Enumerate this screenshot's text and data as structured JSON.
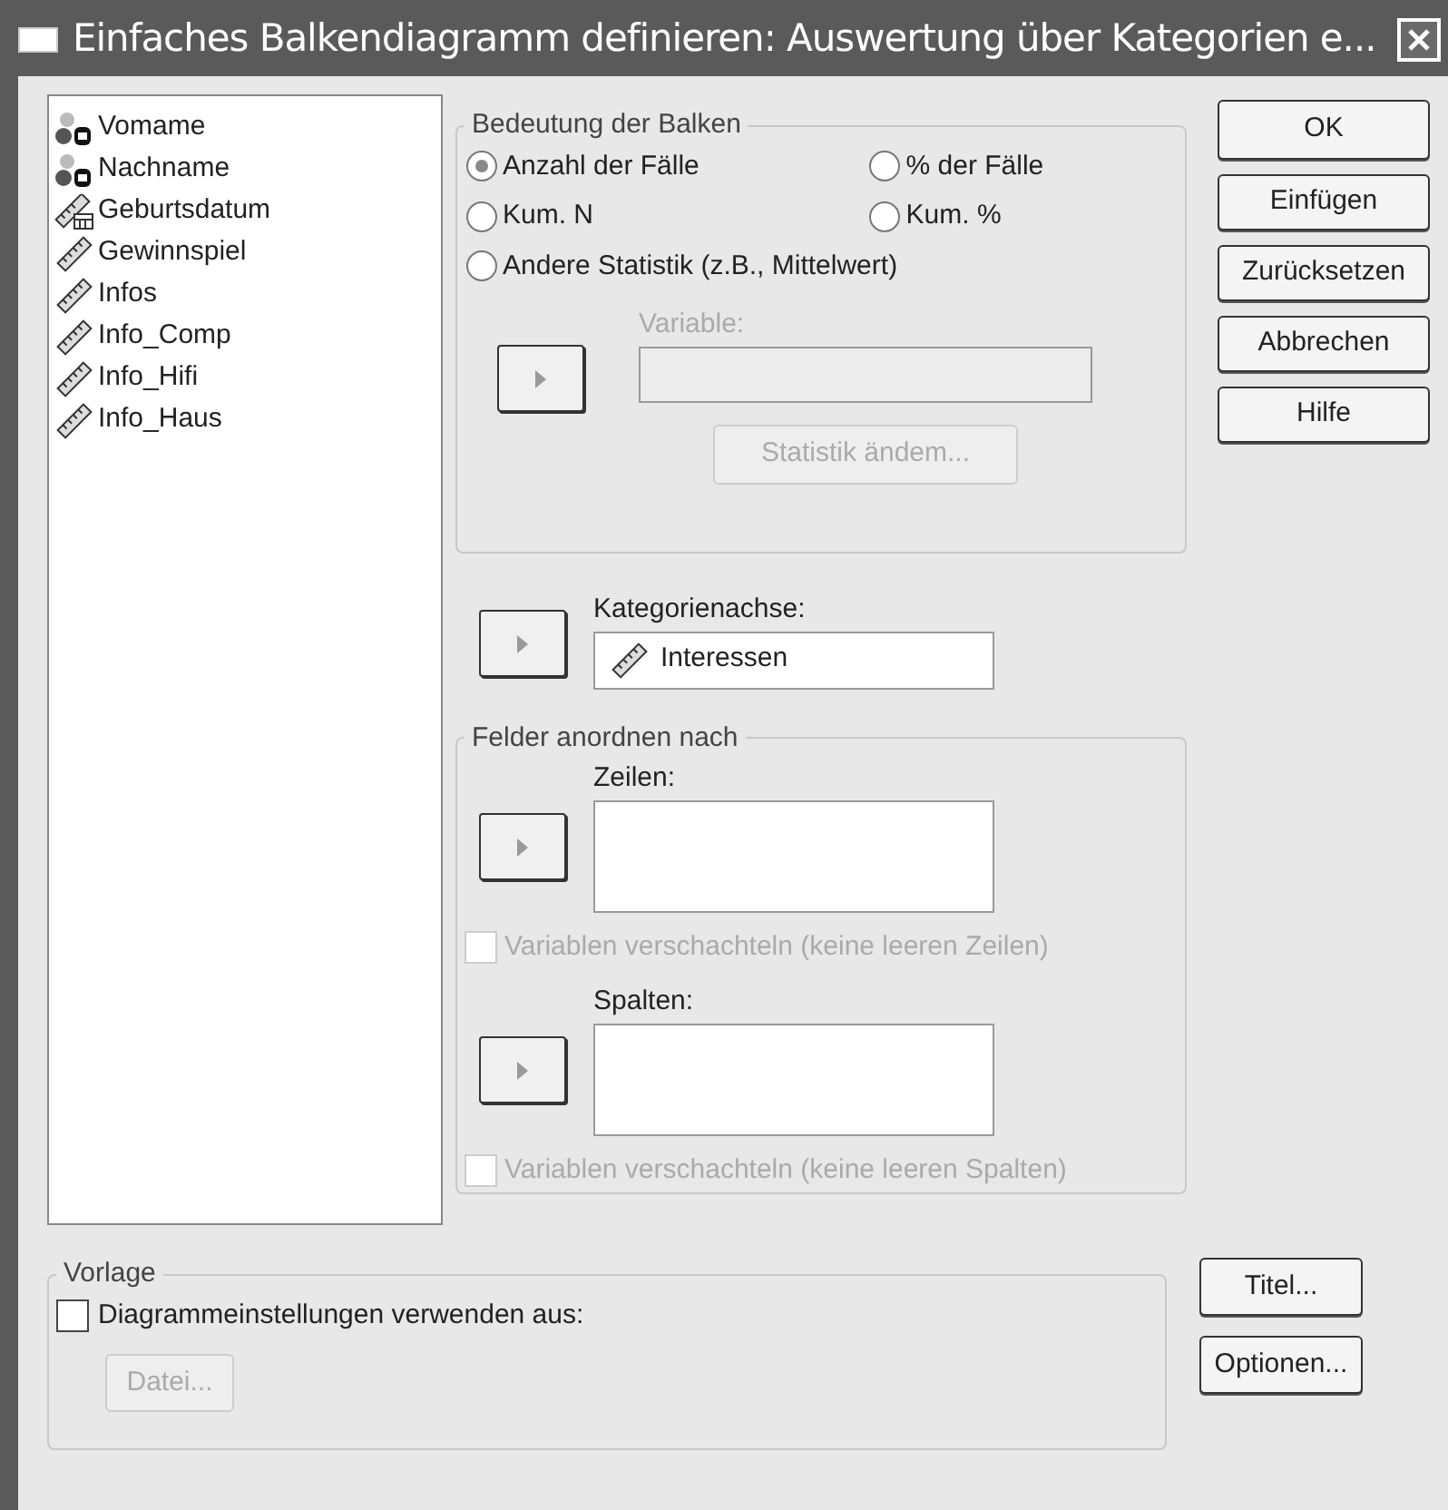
{
  "window": {
    "title": "Einfaches Balkendiagramm definieren: Auswertung über Kategorien e..."
  },
  "variables": [
    {
      "name": "Vomame",
      "kind": "string"
    },
    {
      "name": "Nachname",
      "kind": "string"
    },
    {
      "name": "Geburtsdatum",
      "kind": "date"
    },
    {
      "name": "Gewinnspiel",
      "kind": "scale"
    },
    {
      "name": "Infos",
      "kind": "scale"
    },
    {
      "name": "Info_Comp",
      "kind": "scale"
    },
    {
      "name": "Info_Hifi",
      "kind": "scale"
    },
    {
      "name": "Info_Haus",
      "kind": "scale"
    }
  ],
  "bar_meaning": {
    "legend": "Bedeutung der Balken",
    "options": [
      {
        "label": "Anzahl der Fälle",
        "selected": true
      },
      {
        "label": "% der Fälle",
        "selected": false
      },
      {
        "label": "Kum. N",
        "selected": false
      },
      {
        "label": "Kum. %",
        "selected": false
      },
      {
        "label": "Andere Statistik (z.B., Mittelwert)",
        "selected": false
      }
    ],
    "variable_label": "Variable:",
    "variable_disabled": true,
    "statistic_button": {
      "label": "Statistik ändem...",
      "disabled": true
    }
  },
  "category_axis": {
    "label": "Kategorienachse:",
    "value": "Interessen",
    "kind": "scale"
  },
  "panels": {
    "legend": "Felder anordnen nach",
    "rows_label": "Zeilen:",
    "nest_rows": {
      "label": "Variablen verschachteln (keine leeren Zeilen)",
      "checked": false,
      "disabled": true
    },
    "columns_label": "Spalten:",
    "nest_columns": {
      "label": "Variablen verschachteln (keine leeren Spalten)",
      "checked": false,
      "disabled": true
    }
  },
  "template": {
    "legend": "Vorlage",
    "use_settings": {
      "label": "Diagrammeinstellungen verwenden aus:",
      "checked": false
    },
    "file_button": {
      "label": "Datei...",
      "disabled": true
    }
  },
  "buttons": [
    "OK",
    "Einfügen",
    "Zurücksetzen",
    "Abbrechen",
    "Hilfe"
  ],
  "side_buttons": [
    "Titel...",
    "Optionen..."
  ]
}
